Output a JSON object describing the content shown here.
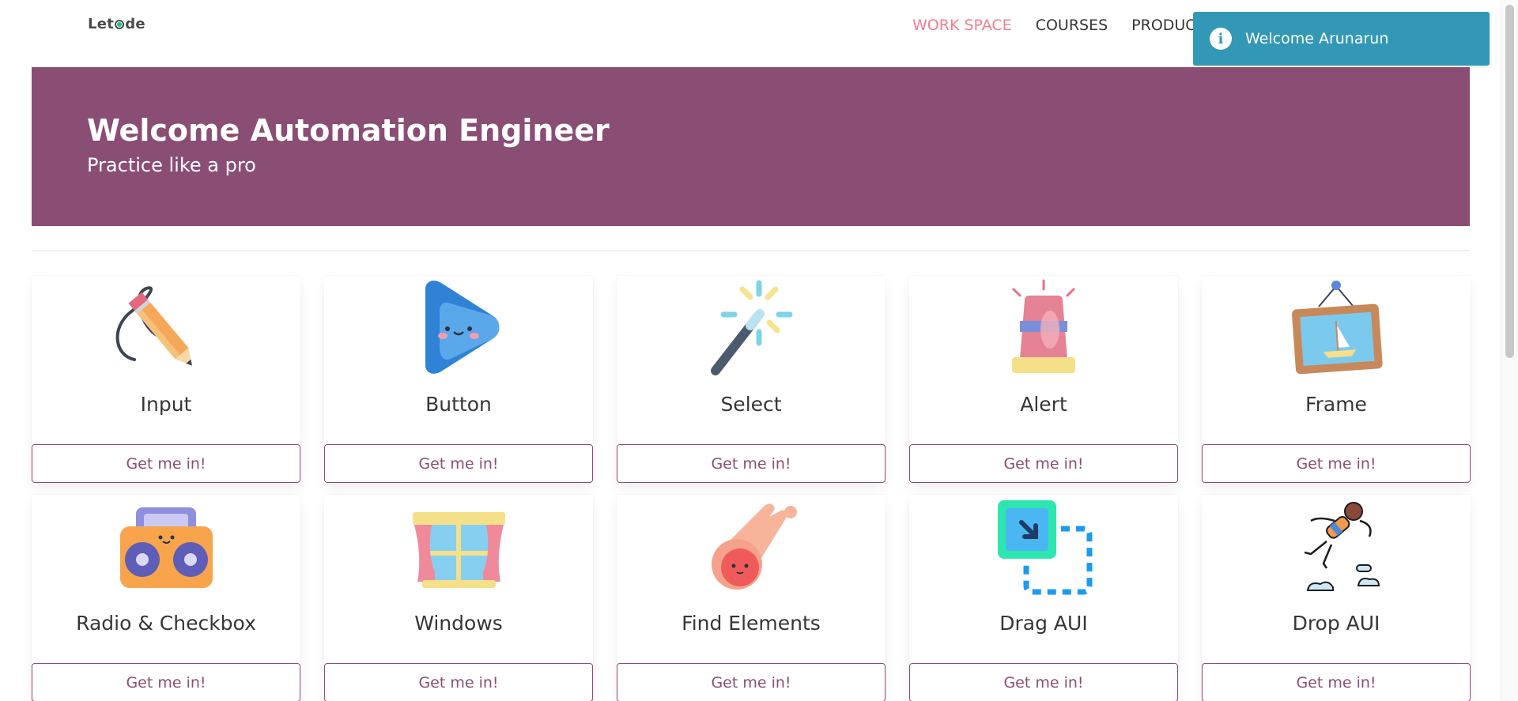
{
  "navbar": {
    "logo": "Letcode",
    "items": [
      {
        "label": "WORK SPACE",
        "active": true
      },
      {
        "label": "COURSES",
        "active": false
      },
      {
        "label": "PRODUCTS",
        "active": false
      }
    ]
  },
  "toast": {
    "message": "Welcome Arunarun",
    "icon": "info-icon",
    "color": "#3298b5"
  },
  "hero": {
    "title": "Welcome Automation Engineer",
    "subtitle": "Practice like a pro",
    "color": "#8a4d74"
  },
  "cards": [
    {
      "title": "Input",
      "button": "Get me in!",
      "icon": "pencil-icon"
    },
    {
      "title": "Button",
      "button": "Get me in!",
      "icon": "play-button-icon"
    },
    {
      "title": "Select",
      "button": "Get me in!",
      "icon": "magic-wand-icon"
    },
    {
      "title": "Alert",
      "button": "Get me in!",
      "icon": "siren-icon"
    },
    {
      "title": "Frame",
      "button": "Get me in!",
      "icon": "picture-frame-icon"
    },
    {
      "title": "Radio & Checkbox",
      "button": "Get me in!",
      "icon": "radio-icon"
    },
    {
      "title": "Windows",
      "button": "Get me in!",
      "icon": "window-icon"
    },
    {
      "title": "Find Elements",
      "button": "Get me in!",
      "icon": "meteor-icon"
    },
    {
      "title": "Drag AUI",
      "button": "Get me in!",
      "icon": "drag-icon"
    },
    {
      "title": "Drop AUI",
      "button": "Get me in!",
      "icon": "skydiver-icon"
    }
  ]
}
